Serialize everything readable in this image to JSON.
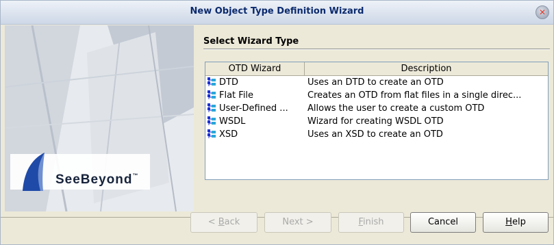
{
  "window": {
    "title": "New Object Type Definition Wizard",
    "close_glyph": "✕"
  },
  "side": {
    "logo_text": "SeeBeyond",
    "logo_tm": "™"
  },
  "content": {
    "heading": "Select Wizard Type",
    "columns": [
      "OTD Wizard",
      "Description"
    ],
    "rows": [
      {
        "name": "DTD",
        "description": "Uses an DTD to create an OTD",
        "icon": "otd-wizard-icon"
      },
      {
        "name": "Flat File",
        "description": "Creates an OTD from flat files in a single direc...",
        "icon": "otd-wizard-icon"
      },
      {
        "name": "User-Defined ...",
        "description": "Allows the user to create a custom OTD",
        "icon": "otd-wizard-icon"
      },
      {
        "name": "WSDL",
        "description": "Wizard for creating WSDL OTD",
        "icon": "otd-wizard-icon"
      },
      {
        "name": "XSD",
        "description": "Uses an XSD to create an OTD",
        "icon": "otd-wizard-icon"
      }
    ]
  },
  "buttons": {
    "back": {
      "prefix": "< ",
      "mnemonic": "B",
      "rest": "ack",
      "enabled": false
    },
    "next": {
      "label": "Next >",
      "enabled": false
    },
    "finish": {
      "mnemonic": "F",
      "rest": "inish",
      "enabled": false
    },
    "cancel": {
      "label": "Cancel",
      "enabled": true
    },
    "help": {
      "mnemonic": "H",
      "rest": "elp",
      "enabled": true
    }
  },
  "colors": {
    "title_text": "#0b2a6e",
    "close_x": "#e23a2a",
    "disabled_text": "#a9a9a9"
  }
}
